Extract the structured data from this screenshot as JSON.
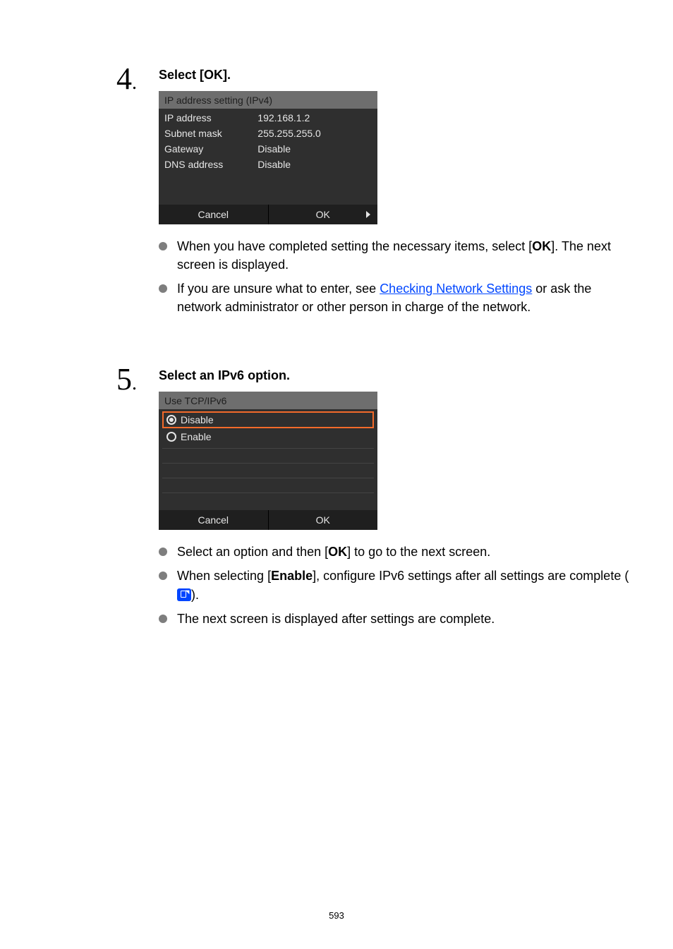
{
  "step4": {
    "number": "4",
    "dot": ".",
    "title": "Select [OK].",
    "shot": {
      "title": "IP address setting (IPv4)",
      "rows": [
        {
          "label": "IP address",
          "value": "192.168.1.2"
        },
        {
          "label": "Subnet mask",
          "value": "255.255.255.0"
        },
        {
          "label": "Gateway",
          "value": "Disable"
        },
        {
          "label": "DNS address",
          "value": "Disable"
        }
      ],
      "cancel": "Cancel",
      "ok": "OK"
    },
    "bullets": {
      "b1_pre": "When you have completed setting the necessary items, select [",
      "b1_bold": "OK",
      "b1_post": "]. The next screen is displayed.",
      "b2_pre": "If you are unsure what to enter, see ",
      "b2_link": "Checking Network Settings",
      "b2_post": " or ask the network administrator or other person in charge of the network."
    }
  },
  "step5": {
    "number": "5",
    "dot": ".",
    "title": "Select an IPv6 option.",
    "shot": {
      "title": "Use TCP/IPv6",
      "opt_disable": "Disable",
      "opt_enable": "Enable",
      "cancel": "Cancel",
      "ok": "OK"
    },
    "bullets": {
      "b1_pre": "Select an option and then [",
      "b1_bold": "OK",
      "b1_post": "] to go to the next screen.",
      "b2_pre": "When selecting [",
      "b2_bold": "Enable",
      "b2_mid": "], configure IPv6 settings after all settings are complete (",
      "b2_post": ").",
      "b3": "The next screen is displayed after settings are complete."
    }
  },
  "pageNumber": "593"
}
